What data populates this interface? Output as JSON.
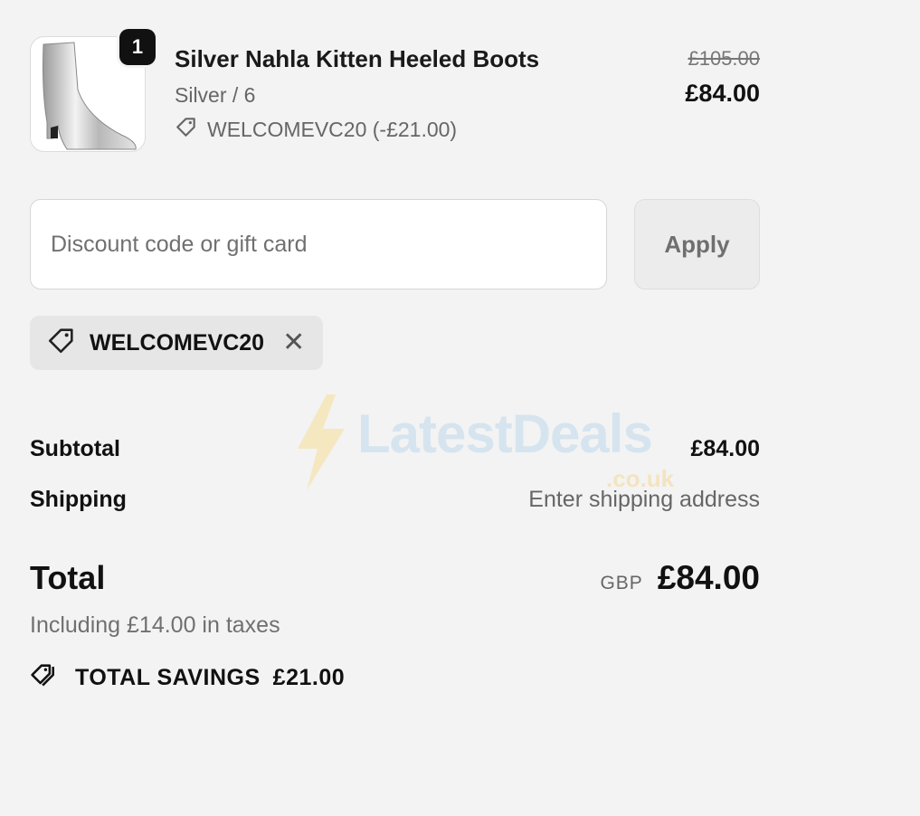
{
  "product": {
    "quantity": "1",
    "title": "Silver Nahla Kitten Heeled Boots",
    "variant": "Silver / 6",
    "discount_line": "WELCOMEVC20 (-£21.00)",
    "original_price": "£105.00",
    "price": "£84.00"
  },
  "discount": {
    "placeholder": "Discount code or gift card",
    "apply_label": "Apply",
    "applied_code": "WELCOMEVC20"
  },
  "summary": {
    "subtotal_label": "Subtotal",
    "subtotal_value": "£84.00",
    "shipping_label": "Shipping",
    "shipping_value": "Enter shipping address",
    "total_label": "Total",
    "currency": "GBP",
    "total_value": "£84.00",
    "tax_note": "Including £14.00 in taxes",
    "savings_label": "TOTAL SAVINGS",
    "savings_value": "£21.00"
  },
  "watermark": {
    "text": "LatestDeals",
    "sub": ".co.uk"
  },
  "icons": [
    "tag-icon",
    "close-icon",
    "tags-icon",
    "bolt-icon"
  ]
}
